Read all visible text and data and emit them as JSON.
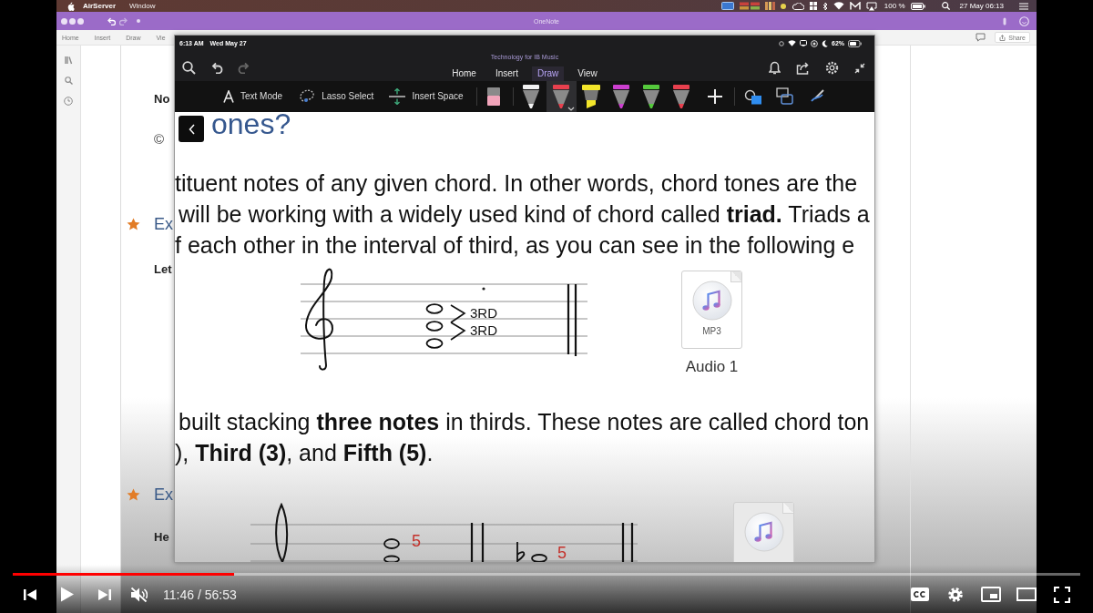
{
  "menu_bar": {
    "app": "AirServer",
    "menus": [
      "Window"
    ],
    "battery": "100 %",
    "clock": "27 May 06:13"
  },
  "onenote": {
    "title": "OneNote",
    "tabs": [
      {
        "label": "Home",
        "selected": false
      },
      {
        "label": "Insert",
        "selected": false
      },
      {
        "label": "Draw",
        "selected": false
      },
      {
        "label": "Vie",
        "selected": false
      }
    ],
    "share": "Share",
    "page": [
      {
        "kind": "bold",
        "text": "No"
      },
      {
        "kind": "symbol",
        "text": "©"
      },
      {
        "kind": "heading",
        "text": "Ex"
      },
      {
        "kind": "bold",
        "text": "Let"
      },
      {
        "kind": "heading",
        "text": "Ex"
      },
      {
        "kind": "bold",
        "text": "He"
      }
    ]
  },
  "ipad": {
    "time": "6:13 AM",
    "date": "Wed May 27",
    "battery": "62%",
    "notebook": "Technology for IB Music",
    "tabs": [
      {
        "label": "Home",
        "selected": false
      },
      {
        "label": "Insert",
        "selected": false
      },
      {
        "label": "Draw",
        "selected": true
      },
      {
        "label": "View",
        "selected": false
      }
    ],
    "tools": [
      {
        "kind": "text",
        "label": "Text Mode"
      },
      {
        "kind": "lasso",
        "label": "Lasso Select"
      },
      {
        "kind": "space",
        "label": "Insert Space"
      }
    ],
    "pens": [
      {
        "kind": "eraser",
        "selected": false
      },
      {
        "kind": "pen",
        "color": "#f2f2f2",
        "selected": false
      },
      {
        "kind": "pen",
        "color": "#e8404e",
        "selected": true
      },
      {
        "kind": "highlighter",
        "color": "#f2e52a",
        "selected": false
      },
      {
        "kind": "pen",
        "color": "#cc3fcf",
        "selected": false
      },
      {
        "kind": "pen",
        "color": "#55c93c",
        "selected": false
      },
      {
        "kind": "pen",
        "color": "#e8404e",
        "selected": false
      }
    ]
  },
  "note": {
    "heading": "ones?",
    "paragraph_1": [
      "tituent notes of any given chord. In other words, chord tones are the",
      "will be working with a widely used kind of chord called **triad.** Triads a",
      "f each other in the interval of third, as you can see in the following e"
    ],
    "example_1": {
      "labels": [
        "3RD",
        "3RD"
      ]
    },
    "audio": {
      "type": "MP3",
      "caption": "Audio 1"
    },
    "paragraph_2": [
      "built stacking **three notes** in thirds. These notes are called chord ton",
      "), **Third (3)**, and **Fifth (5)**."
    ],
    "example_2": {
      "chords": [
        {
          "label": "5",
          "flat": false
        },
        {
          "label": "5",
          "flat": true
        }
      ]
    }
  },
  "player": {
    "progress": {
      "level": 0.207
    },
    "playing": false,
    "muted": true,
    "time": "11:46 / 56:53"
  }
}
